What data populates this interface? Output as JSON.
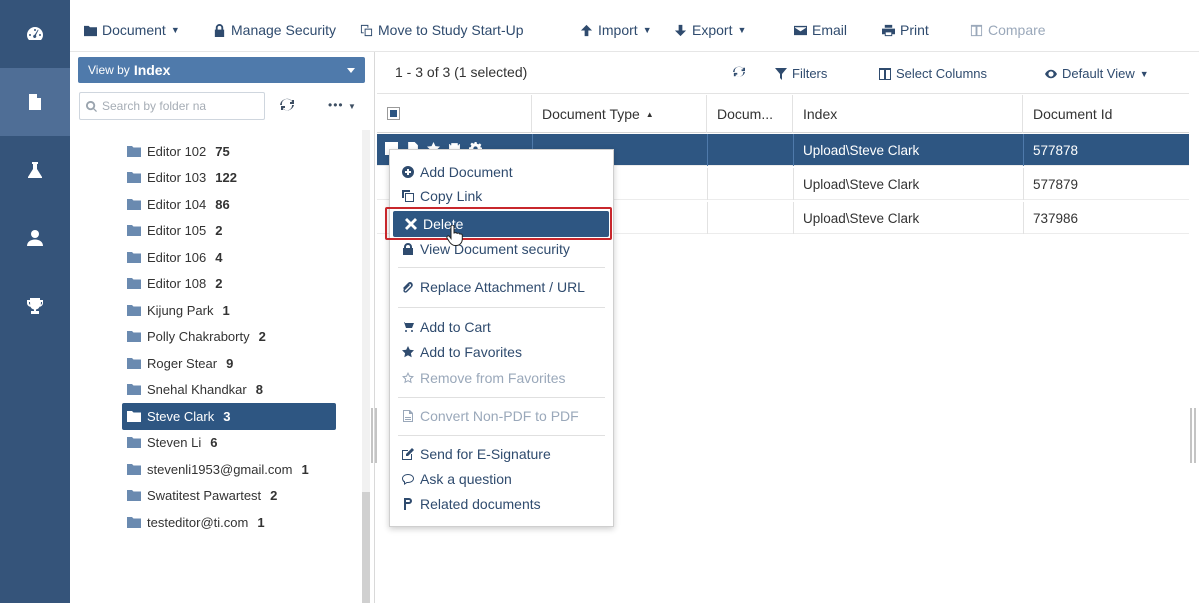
{
  "rail": {
    "items": [
      {
        "name": "dashboard-icon",
        "active": false
      },
      {
        "name": "document-icon",
        "active": true
      },
      {
        "name": "flask-icon",
        "active": false
      },
      {
        "name": "user-icon",
        "active": false
      },
      {
        "name": "trophy-icon",
        "active": false
      }
    ]
  },
  "toolbar": {
    "document": "Document",
    "manage_security": "Manage Security",
    "move_to_study": "Move to Study Start-Up",
    "import": "Import",
    "export": "Export",
    "email": "Email",
    "print": "Print",
    "compare": "Compare"
  },
  "folder_panel": {
    "viewby_prefix": "View by",
    "viewby_value": "Index",
    "search_placeholder": "Search by folder na",
    "more": "•••",
    "folders": [
      {
        "name": "Editor 102",
        "count": "75",
        "selected": false
      },
      {
        "name": "Editor 103",
        "count": "122",
        "selected": false
      },
      {
        "name": "Editor 104",
        "count": "86",
        "selected": false
      },
      {
        "name": "Editor 105",
        "count": "2",
        "selected": false
      },
      {
        "name": "Editor 106",
        "count": "4",
        "selected": false
      },
      {
        "name": "Editor 108",
        "count": "2",
        "selected": false
      },
      {
        "name": "Kijung Park",
        "count": "1",
        "selected": false
      },
      {
        "name": "Polly Chakraborty",
        "count": "2",
        "selected": false
      },
      {
        "name": "Roger Stear",
        "count": "9",
        "selected": false
      },
      {
        "name": "Snehal Khandkar",
        "count": "8",
        "selected": false
      },
      {
        "name": "Steve Clark",
        "count": "3",
        "selected": true
      },
      {
        "name": "Steven Li",
        "count": "6",
        "selected": false
      },
      {
        "name": "stevenli1953@gmail.com",
        "count": "1",
        "selected": false
      },
      {
        "name": "Swatitest Pawartest",
        "count": "2",
        "selected": false
      },
      {
        "name": "testeditor@ti.com",
        "count": "1",
        "selected": false
      }
    ]
  },
  "grid": {
    "count_text": "1 - 3 of 3 (1 selected)",
    "filters": "Filters",
    "select_columns": "Select Columns",
    "default_view": "Default View",
    "columns": [
      "Document Type",
      "Docum...",
      "Index",
      "Document Id"
    ],
    "rows": [
      {
        "index": "Upload\\Steve Clark",
        "doc_id": "577878",
        "selected": true
      },
      {
        "index": "Upload\\Steve Clark",
        "doc_id": "577879",
        "selected": false
      },
      {
        "index": "Upload\\Steve Clark",
        "doc_id": "737986",
        "selected": false
      }
    ]
  },
  "context_menu": {
    "add_document": "Add Document",
    "copy_link": "Copy Link",
    "delete": "Delete",
    "view_security": "View Document security",
    "replace_attachment": "Replace Attachment / URL",
    "add_to_cart": "Add to Cart",
    "add_to_favorites": "Add to Favorites",
    "remove_from_favorites": "Remove from Favorites",
    "convert_pdf": "Convert Non-PDF to PDF",
    "send_esignature": "Send for E-Signature",
    "ask_question": "Ask a question",
    "related_documents": "Related documents"
  },
  "colors": {
    "rail": "#35547a",
    "accent": "#2e5682",
    "viewby": "#4f7aab",
    "highlight": "#c8272c"
  }
}
